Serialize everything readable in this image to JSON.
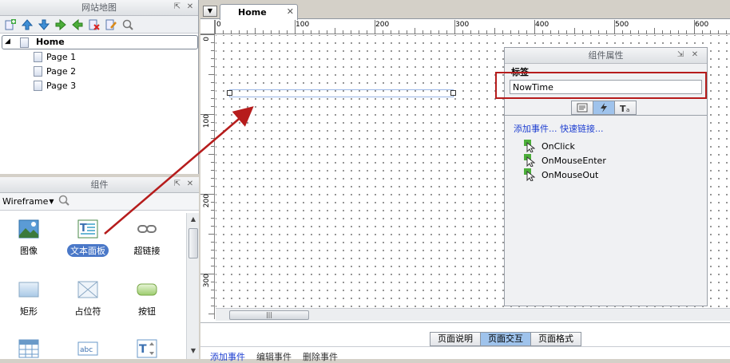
{
  "sitemap": {
    "title": "网站地图",
    "pin_icon": "pin-icon",
    "close_icon": "close-icon",
    "toolbar_icons": [
      "add-child-page-icon",
      "move-up-icon",
      "move-down-icon",
      "indent-icon",
      "outdent-icon",
      "delete-page-icon",
      "edit-page-icon",
      "search-icon"
    ],
    "root": "Home",
    "pages": [
      "Page 1",
      "Page 2",
      "Page 3"
    ]
  },
  "widgets": {
    "title": "组件",
    "library": "Wireframe",
    "items": [
      {
        "label": "图像",
        "icon": "image-icon",
        "selected": false
      },
      {
        "label": "文本面板",
        "icon": "text-panel-icon",
        "selected": true
      },
      {
        "label": "超链接",
        "icon": "hyperlink-icon",
        "selected": false
      },
      {
        "label": "矩形",
        "icon": "rectangle-icon",
        "selected": false
      },
      {
        "label": "占位符",
        "icon": "placeholder-icon",
        "selected": false
      },
      {
        "label": "按钮",
        "icon": "button-icon",
        "selected": false
      },
      {
        "label": "",
        "icon": "table-icon",
        "selected": false
      },
      {
        "label": "",
        "icon": "text-field-icon",
        "selected": false
      },
      {
        "label": "",
        "icon": "text-area-icon",
        "selected": false
      }
    ]
  },
  "editor": {
    "tab_label": "Home",
    "ruler_top": [
      "0",
      "100",
      "200",
      "300",
      "400",
      "500",
      "600"
    ],
    "ruler_left": [
      "0",
      "100",
      "200",
      "300"
    ]
  },
  "properties": {
    "title": "组件属性",
    "label_caption": "标签",
    "name_value": "NowTime",
    "tab_icons": [
      "notes-icon",
      "interactions-icon",
      "style-icon"
    ],
    "active_tab": "interactions-icon",
    "event_links": "添加事件...  快速链接...",
    "events": [
      "OnClick",
      "OnMouseEnter",
      "OnMouseOut"
    ]
  },
  "bottom": {
    "tabs": [
      "页面说明",
      "页面交互",
      "页面格式"
    ],
    "active_tab": "页面交互",
    "links": [
      "添加事件",
      "编辑事件",
      "删除事件"
    ]
  },
  "colors": {
    "accent": "#4a78c8",
    "highlight_box": "#b61c1c",
    "link": "#1e3fd1",
    "active_tab": "#9fc3ec"
  }
}
